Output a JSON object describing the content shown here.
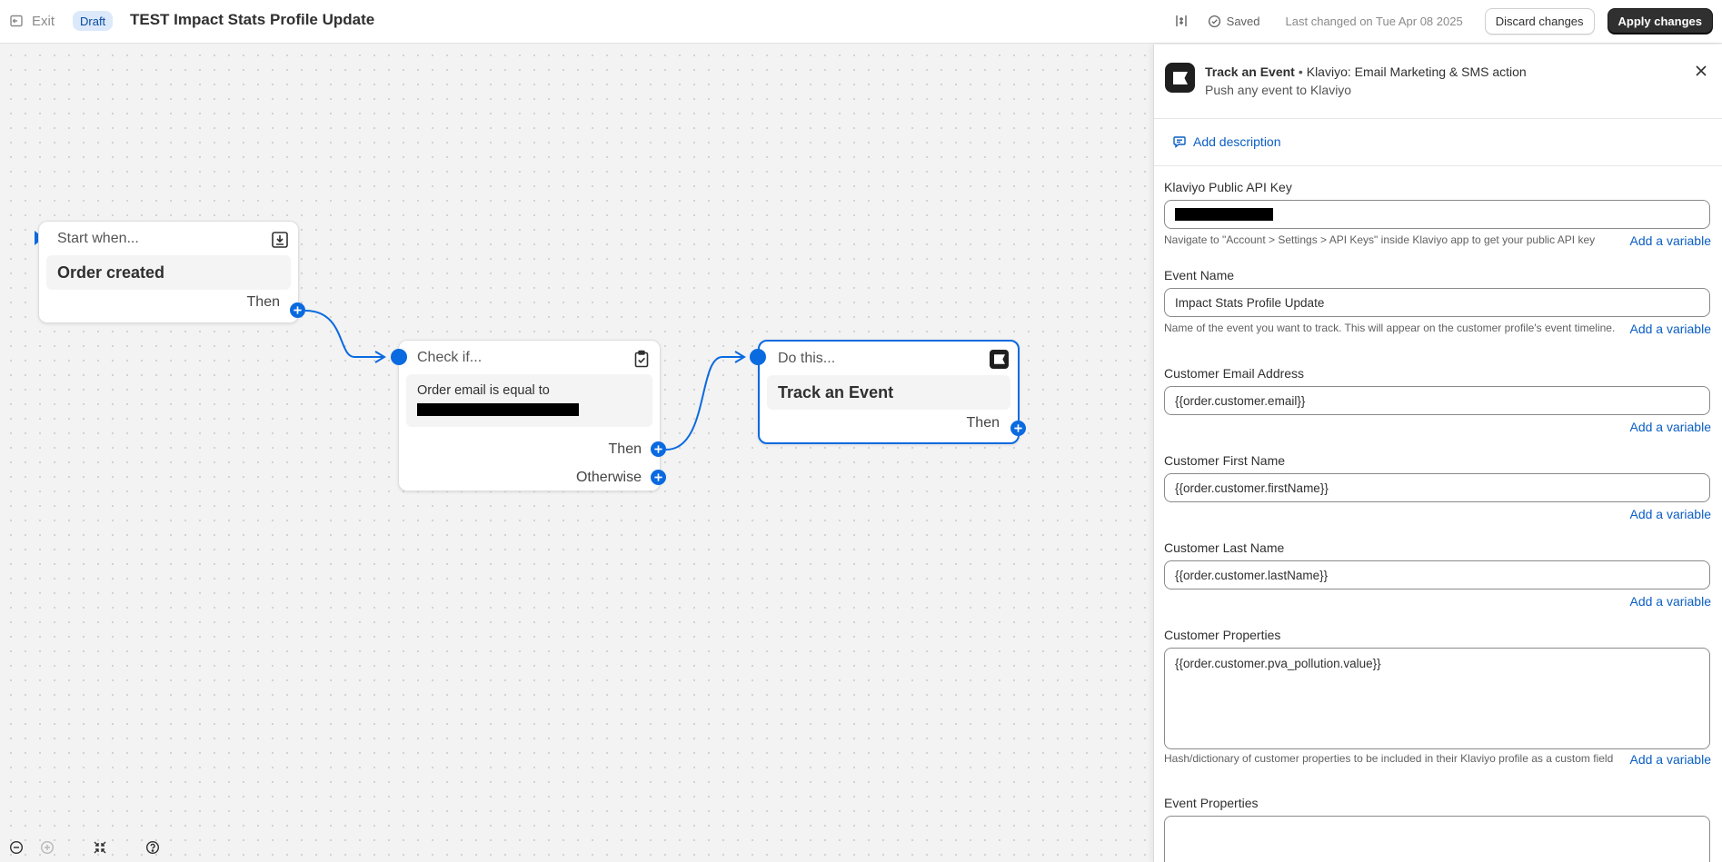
{
  "topbar": {
    "exit_label": "Exit",
    "status_badge": "Draft",
    "title": "TEST Impact Stats Profile Update",
    "saved_label": "Saved",
    "last_changed": "Last changed on Tue Apr 08 2025",
    "discard_label": "Discard changes",
    "apply_label": "Apply changes"
  },
  "workflow": {
    "trigger": {
      "header": "Start when...",
      "title": "Order created",
      "then_label": "Then",
      "icon": "download-icon"
    },
    "condition": {
      "header": "Check if...",
      "text": "Order email is equal to",
      "then_label": "Then",
      "otherwise_label": "Otherwise",
      "icon": "clipboard-check-icon"
    },
    "action": {
      "header": "Do this...",
      "title": "Track an Event",
      "then_label": "Then",
      "icon": "klaviyo-flag-icon"
    }
  },
  "panel": {
    "title": "Track an Event",
    "app": "Klaviyo: Email Marketing & SMS action",
    "subtitle": "Push any event to Klaviyo",
    "add_description": "Add description",
    "add_variable": "Add a variable",
    "fields": [
      {
        "label": "Klaviyo Public API Key",
        "value": "",
        "help": "Navigate to \"Account > Settings > API Keys\" inside Klaviyo app to get your public API key"
      },
      {
        "label": "Event Name",
        "value": "Impact Stats Profile Update",
        "help": "Name of the event you want to track. This will appear on the customer profile's event timeline."
      },
      {
        "label": "Customer Email Address",
        "value": "{{order.customer.email}}",
        "help": ""
      },
      {
        "label": "Customer First Name",
        "value": "{{order.customer.firstName}}",
        "help": ""
      },
      {
        "label": "Customer Last Name",
        "value": "{{order.customer.lastName}}",
        "help": ""
      },
      {
        "label": "Customer Properties",
        "value": "{{order.customer.pva_pollution.value}}",
        "help": "Hash/dictionary of customer properties to be included in their Klaviyo profile as a custom field"
      },
      {
        "label": "Event Properties",
        "value": "",
        "help": ""
      }
    ]
  },
  "colors": {
    "accent": "#0a6ae0",
    "link": "#0a5ec4",
    "primary_button": "#303030",
    "draft_badge_bg": "#dbe9fb"
  }
}
